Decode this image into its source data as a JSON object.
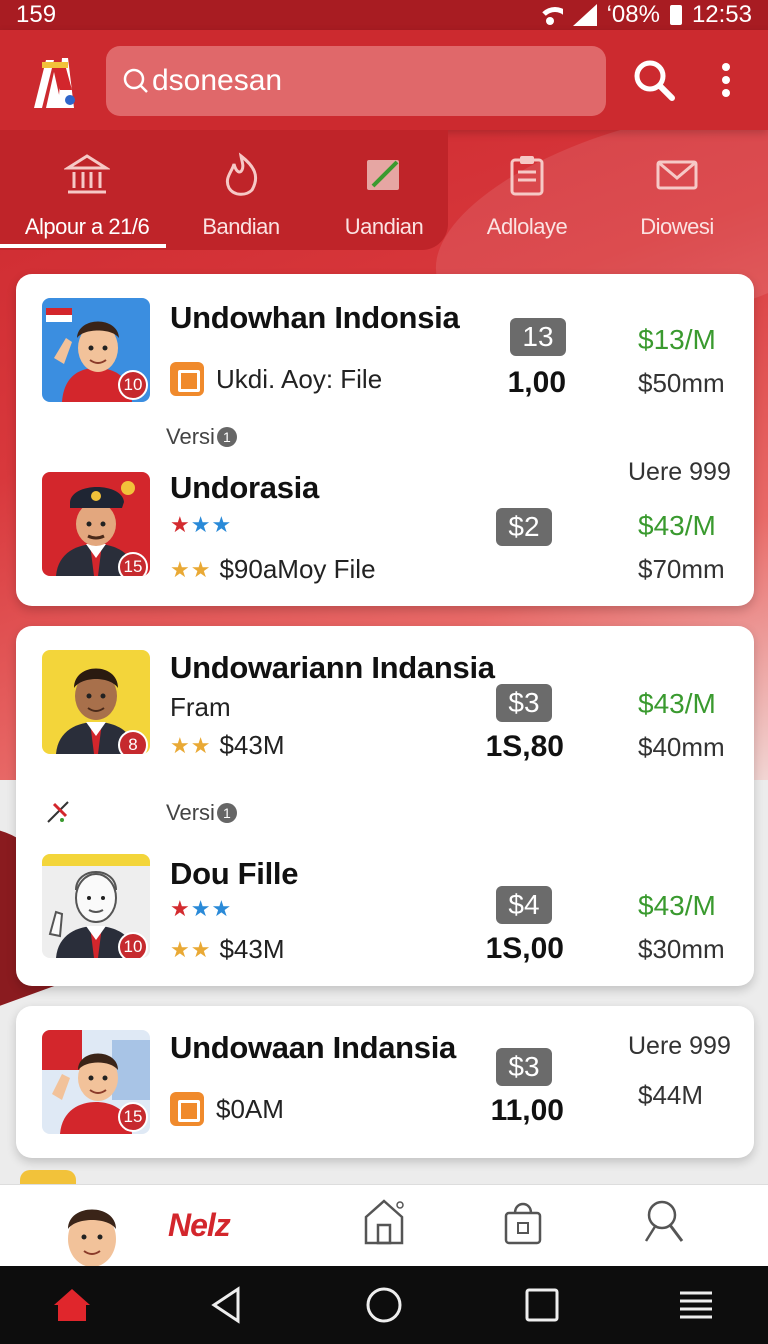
{
  "status_bar": {
    "left_text": "159",
    "battery": "‘08%",
    "time": "12:53"
  },
  "app_bar": {
    "search_value": "dsonesan",
    "icons": [
      "app-logo",
      "search-icon",
      "more-vert-icon"
    ]
  },
  "tabs": [
    {
      "label": "Alpour a 21/6",
      "icon": "bank-icon",
      "active": true
    },
    {
      "label": "Bandian",
      "icon": "flame-icon",
      "active": false
    },
    {
      "label": "Uandian",
      "icon": "edit-icon",
      "active": false
    },
    {
      "label": "Adlolaye",
      "icon": "clipboard-icon",
      "active": false
    },
    {
      "label": "Diowesi",
      "icon": "mail-icon",
      "active": false
    }
  ],
  "cards": [
    {
      "rows": [
        {
          "title": "Undowhan Indonsia",
          "sub": "Ukdi. Aoy: File",
          "badge": "10",
          "pill": "13",
          "mid": "1,00",
          "right_top": "$13/M",
          "right_bottom": "$50mm"
        },
        {
          "title": "Undorasia",
          "stars_top": "★★★",
          "sub": "$90aMoy File",
          "badge": "15",
          "pill": "$2",
          "right_label": "Uere 999",
          "right_top": "$43/M",
          "right_bottom": "$70mm"
        }
      ],
      "versi": "Versi",
      "versi_num": "1"
    },
    {
      "rows": [
        {
          "title": "Undowariann Indansia",
          "sub_top": "Fram",
          "sub": "$43M",
          "badge": "8",
          "pill": "$3",
          "mid": "1S,80",
          "right_top": "$43/M",
          "right_bottom": "$40mm"
        },
        {
          "title": "Dou Fille",
          "stars_top": "★★★",
          "sub": "$43M",
          "badge": "10",
          "pill": "$4",
          "mid": "1S,00",
          "right_top": "$43/M",
          "right_bottom": "$30mm"
        }
      ],
      "versi": "Versi",
      "versi_num": "1"
    },
    {
      "rows": [
        {
          "title": "Undowaan Indansia",
          "sub": "$0AM",
          "badge": "15",
          "pill": "$3",
          "mid": "11,00",
          "right_label": "Uere 999",
          "right_bottom": "$44M"
        }
      ]
    }
  ],
  "bottom_nav": {
    "brand": "Nelz",
    "items": [
      "profile-avatar",
      "home-icon",
      "shopping-bag-icon",
      "search-icon"
    ]
  },
  "system_nav": [
    "home-icon",
    "back-icon",
    "circle-home-icon",
    "recents-icon",
    "menu-icon"
  ],
  "colors": {
    "primary": "#cc2a2f",
    "green": "#3a9a2f",
    "pill": "#6b6b6b"
  }
}
